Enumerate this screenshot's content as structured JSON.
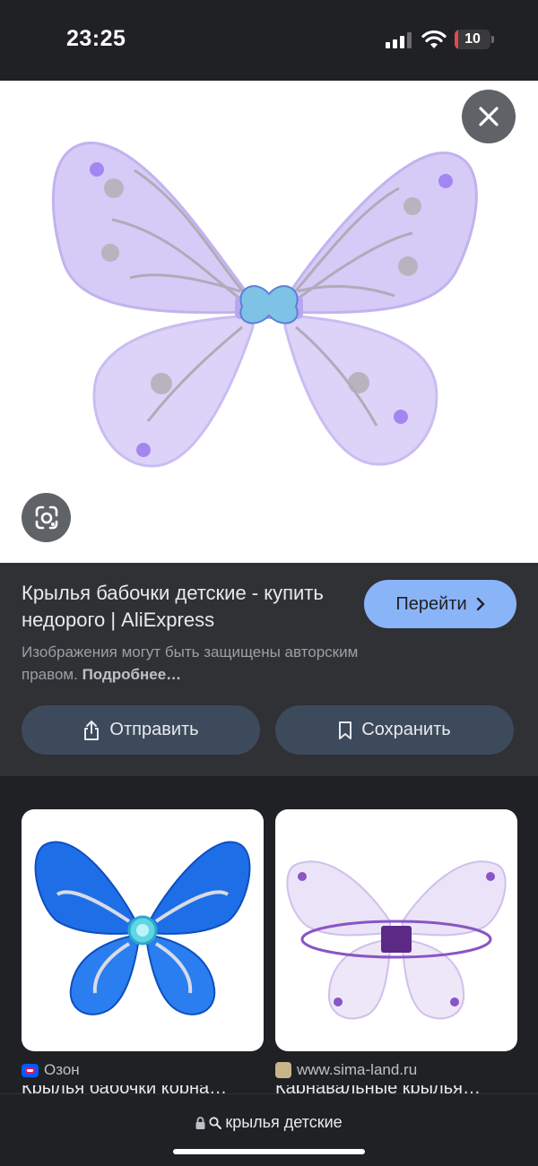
{
  "status_bar": {
    "time": "23:25",
    "battery": "10",
    "battery_level": 0.1,
    "battery_color": "#e5484d"
  },
  "hero": {
    "close_icon": "close-icon",
    "lens_icon": "google-lens-icon"
  },
  "result": {
    "title": "Крылья бабочки детские - купить недорого | AliExpress",
    "visit_label": "Перейти",
    "copyright_text": "Изображения могут быть защищены авторским правом.",
    "copyright_link": "Подробнее…",
    "share_label": "Отправить",
    "save_label": "Сохранить"
  },
  "related": [
    {
      "source": "Озон",
      "snippet": "Крылья бабочки корна…"
    },
    {
      "source": "www.sima-land.ru",
      "snippet": "Карнавальные крылья…"
    }
  ],
  "search_bar": {
    "query": "крылья детские"
  },
  "colors": {
    "accent": "#8ab4f8",
    "panel": "#303134",
    "background": "#202124"
  }
}
